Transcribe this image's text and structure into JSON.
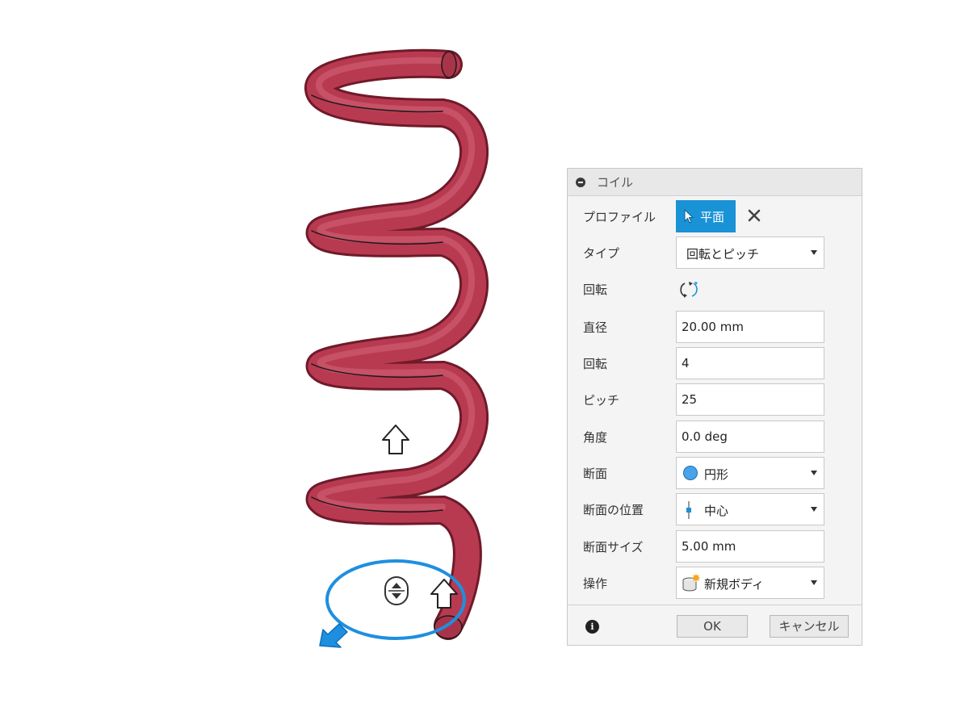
{
  "dialog": {
    "title": "コイル",
    "profile": {
      "label": "プロファイル",
      "button": "平面"
    },
    "type": {
      "label": "タイプ",
      "value": "回転とピッチ"
    },
    "rotation_dir": {
      "label": "回転",
      "icon": "rotate-direction-icon"
    },
    "diameter": {
      "label": "直径",
      "value": "20.00 mm"
    },
    "revolutions": {
      "label": "回転",
      "value": "4"
    },
    "pitch": {
      "label": "ピッチ",
      "value": "25"
    },
    "angle": {
      "label": "角度",
      "value": "0.0 deg"
    },
    "section": {
      "label": "断面",
      "value": "円形",
      "icon": "circle-icon"
    },
    "section_position": {
      "label": "断面の位置",
      "value": "中心",
      "icon": "center-position-icon"
    },
    "section_size": {
      "label": "断面サイズ",
      "value": "5.00 mm"
    },
    "operation": {
      "label": "操作",
      "value": "新規ボディ",
      "icon": "new-body-icon"
    },
    "ok": "OK",
    "cancel": "キャンセル"
  },
  "colors": {
    "coil": "#b83a50",
    "accent": "#1a92d6",
    "manipulator": "#1e8fe0"
  }
}
